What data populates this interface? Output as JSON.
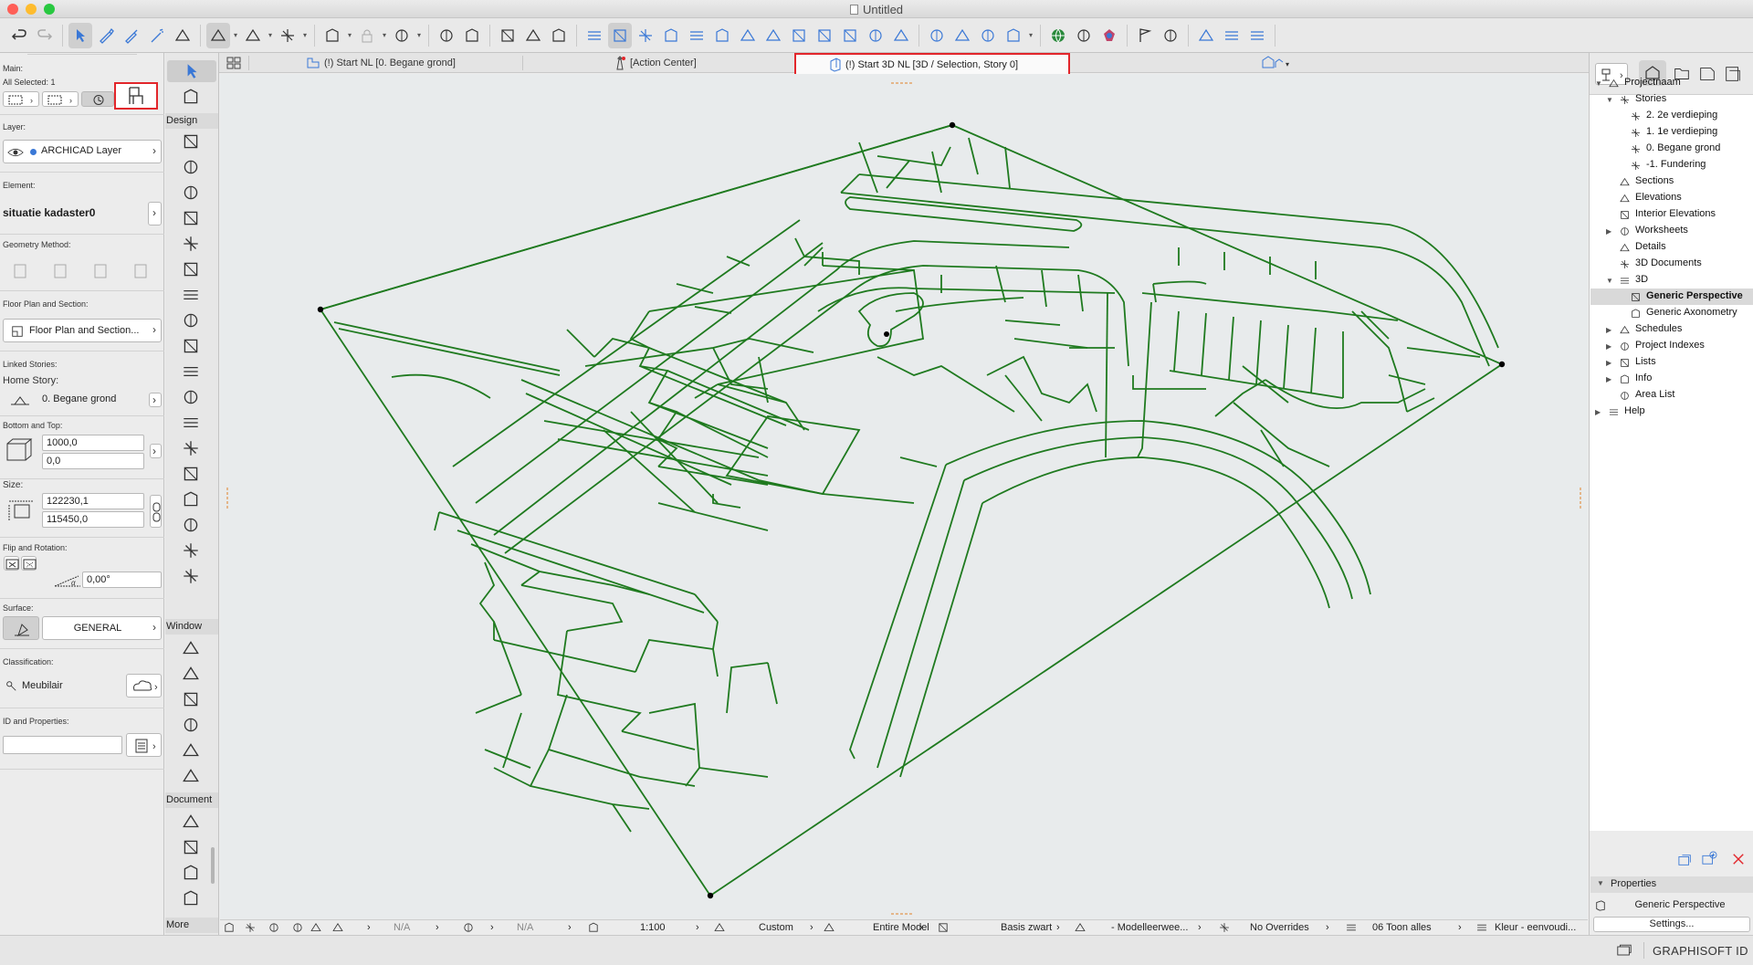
{
  "window": {
    "title": "Untitled"
  },
  "colors": {
    "close": "#ff5f57",
    "minimize": "#febc2e",
    "zoom": "#28c840",
    "accent": "#e2262b",
    "drawing": "#1f7a1f",
    "canvas": "#e8ebec"
  },
  "toolbar": {
    "groups": [
      [
        "undo-icon",
        "redo-icon"
      ],
      [
        "arrow-select-icon",
        "pen-icon",
        "syringe-icon",
        "magic-wand-icon",
        "fit-icon"
      ],
      [
        "snap-guide-icon",
        "guide-line-icon",
        "grid-snap-icon"
      ],
      [
        "layer-toggle-icon",
        "lock-icon",
        "dimension-icon"
      ],
      [
        "stack-icon",
        "hatch-icon"
      ],
      [
        "dim-linear-icon",
        "dim-angular-icon",
        "dim-radial-icon"
      ],
      [
        "mirror-icon",
        "drag-icon",
        "rotate-icon",
        "elevate-icon",
        "offset-icon",
        "trim-icon",
        "adjust-icon",
        "intersect-icon",
        "fillet-icon",
        "split-icon",
        "resize-icon",
        "roof-icon",
        "group-icon"
      ],
      [
        "solid-ops-icon",
        "explode-icon",
        "ungroup-icon",
        "connect-icon"
      ],
      [
        "globe-icon",
        "teamwork-icon",
        "render-icon"
      ],
      [
        "flag-icon",
        "markup-icon"
      ],
      [
        "publish-icon",
        "sync-icon",
        "bimcloud-icon"
      ]
    ]
  },
  "tabs": [
    {
      "label": "(!) Start NL [0. Begane grond]",
      "icon": "floor-plan-icon"
    },
    {
      "label": "[Action Center]",
      "icon": "lighthouse-icon"
    },
    {
      "label": "(!) Start 3D NL [3D / Selection, Story 0]",
      "icon": "3d-window-icon",
      "active": true
    }
  ],
  "infobox": {
    "main_label": "Main:",
    "selected_label": "All Selected: 1",
    "layer_label": "Layer:",
    "layer_value": "ARCHICAD Layer",
    "element_label": "Element:",
    "element_value": "situatie kadaster0",
    "geometry_label": "Geometry Method:",
    "floorplan_label": "Floor Plan and Section:",
    "floorplan_value": "Floor Plan and Section...",
    "linked_label": "Linked Stories:",
    "home_label": "Home Story:",
    "home_value": "0. Begane grond",
    "bottomtop_label": "Bottom and Top:",
    "bottom_value": "1000,0",
    "top_value": "0,0",
    "size_label": "Size:",
    "size_x": "122230,1",
    "size_y": "115450,0",
    "flip_label": "Flip and Rotation:",
    "rotation_value": "0,00°",
    "surface_label": "Surface:",
    "surface_value": "GENERAL",
    "classification_label": "Classification:",
    "classification_value": "Meubilair",
    "id_label": "ID and Properties:",
    "id_value": ""
  },
  "toolbox": {
    "design_label": "Design",
    "window_label": "Window",
    "document_label": "Document",
    "more_label": "More",
    "design_tools": [
      "wall-icon",
      "slab-icon",
      "roof-icon",
      "shell-icon",
      "beam-icon",
      "column-icon",
      "curtain-wall-icon",
      "door-icon",
      "window-icon",
      "stair-icon",
      "railing-icon",
      "mesh-icon",
      "object-icon",
      "lamp-icon",
      "zone-icon",
      "morph-icon",
      "slab-extra-icon",
      "skylight-icon"
    ],
    "window_tools": [
      "section-icon",
      "elevation-icon",
      "interior-elevation-icon",
      "worksheet-icon",
      "detail-icon",
      "camera-icon"
    ],
    "document_tools": [
      "fill-icon",
      "line-icon",
      "circle-icon",
      "polyline-icon"
    ]
  },
  "navigator": {
    "root": "Projectnaam",
    "items": [
      {
        "label": "Stories",
        "level": 1,
        "icon": "story-icon",
        "open": true
      },
      {
        "label": "2. 2e verdieping",
        "level": 2,
        "icon": "story-icon"
      },
      {
        "label": "1. 1e verdieping",
        "level": 2,
        "icon": "story-icon"
      },
      {
        "label": "0. Begane grond",
        "level": 2,
        "icon": "story-icon"
      },
      {
        "label": "-1. Fundering",
        "level": 2,
        "icon": "story-icon"
      },
      {
        "label": "Sections",
        "level": 1,
        "icon": "section-icon"
      },
      {
        "label": "Elevations",
        "level": 1,
        "icon": "elevation-icon"
      },
      {
        "label": "Interior Elevations",
        "level": 1,
        "icon": "interior-elevation-icon"
      },
      {
        "label": "Worksheets",
        "level": 1,
        "icon": "worksheet-icon",
        "closed": true
      },
      {
        "label": "Details",
        "level": 1,
        "icon": "detail-icon"
      },
      {
        "label": "3D Documents",
        "level": 1,
        "icon": "3d-document-icon"
      },
      {
        "label": "3D",
        "level": 1,
        "icon": "3d-icon",
        "open": true
      },
      {
        "label": "Generic Perspective",
        "level": 2,
        "icon": "perspective-icon",
        "selected": true
      },
      {
        "label": "Generic Axonometry",
        "level": 2,
        "icon": "axonometry-icon"
      },
      {
        "label": "Schedules",
        "level": 1,
        "icon": "schedule-icon",
        "closed": true
      },
      {
        "label": "Project Indexes",
        "level": 1,
        "icon": "index-icon",
        "closed": true
      },
      {
        "label": "Lists",
        "level": 1,
        "icon": "list-icon",
        "closed": true
      },
      {
        "label": "Info",
        "level": 1,
        "icon": "info-icon",
        "closed": true
      },
      {
        "label": "Area List",
        "level": 1,
        "icon": "area-list-icon"
      },
      {
        "label": "Help",
        "level": 0,
        "icon": "help-icon",
        "closed": true
      }
    ]
  },
  "properties": {
    "header": "Properties",
    "view_name": "Generic Perspective",
    "settings_label": "Settings..."
  },
  "statusbar": {
    "scale": "1:100",
    "layer_combo": "Custom",
    "structure": "Entire Model",
    "pen_set": "Basis zwart",
    "model_view": "- Modelleerwee...",
    "overrides": "No Overrides",
    "renovation": "06 Toon alles",
    "kleur": "Kleur - eenvoudi...",
    "na1": "N/A",
    "na2": "N/A"
  },
  "footer": {
    "brand": "GRAPHISOFT ID"
  }
}
